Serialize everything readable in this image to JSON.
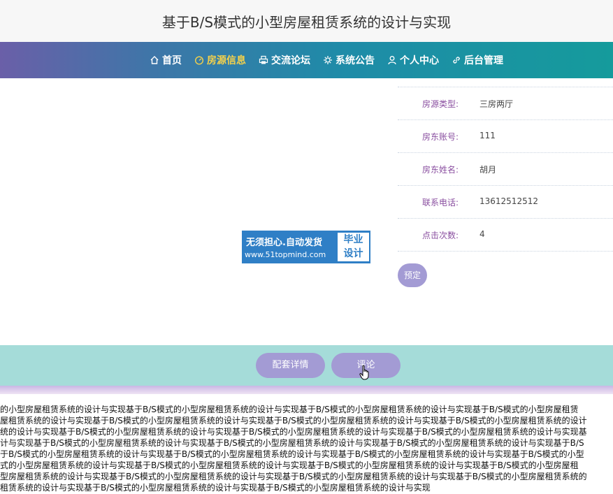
{
  "header": {
    "title": "基于B/S模式的小型房屋租赁系统的设计与实现"
  },
  "nav": {
    "items": [
      {
        "label": "首页",
        "icon": "home-icon"
      },
      {
        "label": "房源信息",
        "icon": "gauge-icon"
      },
      {
        "label": "交流论坛",
        "icon": "printer-icon"
      },
      {
        "label": "系统公告",
        "icon": "gear-icon"
      },
      {
        "label": "个人中心",
        "icon": "user-icon"
      },
      {
        "label": "后台管理",
        "icon": "link-icon"
      }
    ],
    "active": "房源信息"
  },
  "ad": {
    "line1": "无须担心.自动发货",
    "line2": "www.51topmind.com",
    "right1": "毕业",
    "right2": "设计"
  },
  "details": [
    {
      "label": "房源类型:",
      "value": "三房两厅"
    },
    {
      "label": "房东账号:",
      "value": "111"
    },
    {
      "label": "房东姓名:",
      "value": "胡月"
    },
    {
      "label": "联系电话:",
      "value": "13612512512"
    },
    {
      "label": "点击次数:",
      "value": "4"
    }
  ],
  "actions": {
    "book_label": "预定"
  },
  "tabs": {
    "detail_label": "配套详情",
    "comment_label": "评论"
  },
  "footer": {
    "lines": [
      "的小型房屋租赁系统的设计与实现基于B/S模式的小型房屋租赁系统的设计与实现基于B/S模式的小型房屋租赁系统的设计与实现基于B/S模式的小型房屋租赁",
      "屋租赁系统的设计与实现基于B/S模式的小型房屋租赁系统的设计与实现基于B/S模式的小型房屋租赁系统的设计与实现基于B/S模式的小型房屋租赁系统的设计",
      "统的设计与实现基于B/S模式的小型房屋租赁系统的设计与实现基于B/S模式的小型房屋租赁系统的设计与实现基于B/S模式的小型房屋租赁系统的设计与实现基",
      "计与实现基于B/S模式的小型房屋租赁系统的设计与实现基于B/S模式的小型房屋租赁系统的设计与实现基于B/S模式的小型房屋租赁系统的设计与实现基于B/S",
      "于B/S模式的小型房屋租赁系统的设计与实现基于B/S模式的小型房屋租赁系统的设计与实现基于B/S模式的小型房屋租赁系统的设计与实现基于B/S模式的小型",
      "式的小型房屋租赁系统的设计与实现基于B/S模式的小型房屋租赁系统的设计与实现基于B/S模式的小型房屋租赁系统的设计与实现基于B/S模式的小型房屋租",
      "型房屋租赁系统的设计与实现基于B/S模式的小型房屋租赁系统的设计与实现基于B/S模式的小型房屋租赁系统的设计与实现基于B/S模式的小型房屋租赁系统的",
      "租赁系统的设计与实现基于B/S模式的小型房屋租赁系统的设计与实现基于B/S模式的小型房屋租赁系统的设计与实现"
    ]
  },
  "colors": {
    "nav_active": "#f5d14a",
    "label_purple": "#8a4fa0",
    "button_lavender": "#a39bd4",
    "tab_bar": "#a5dcd9"
  }
}
